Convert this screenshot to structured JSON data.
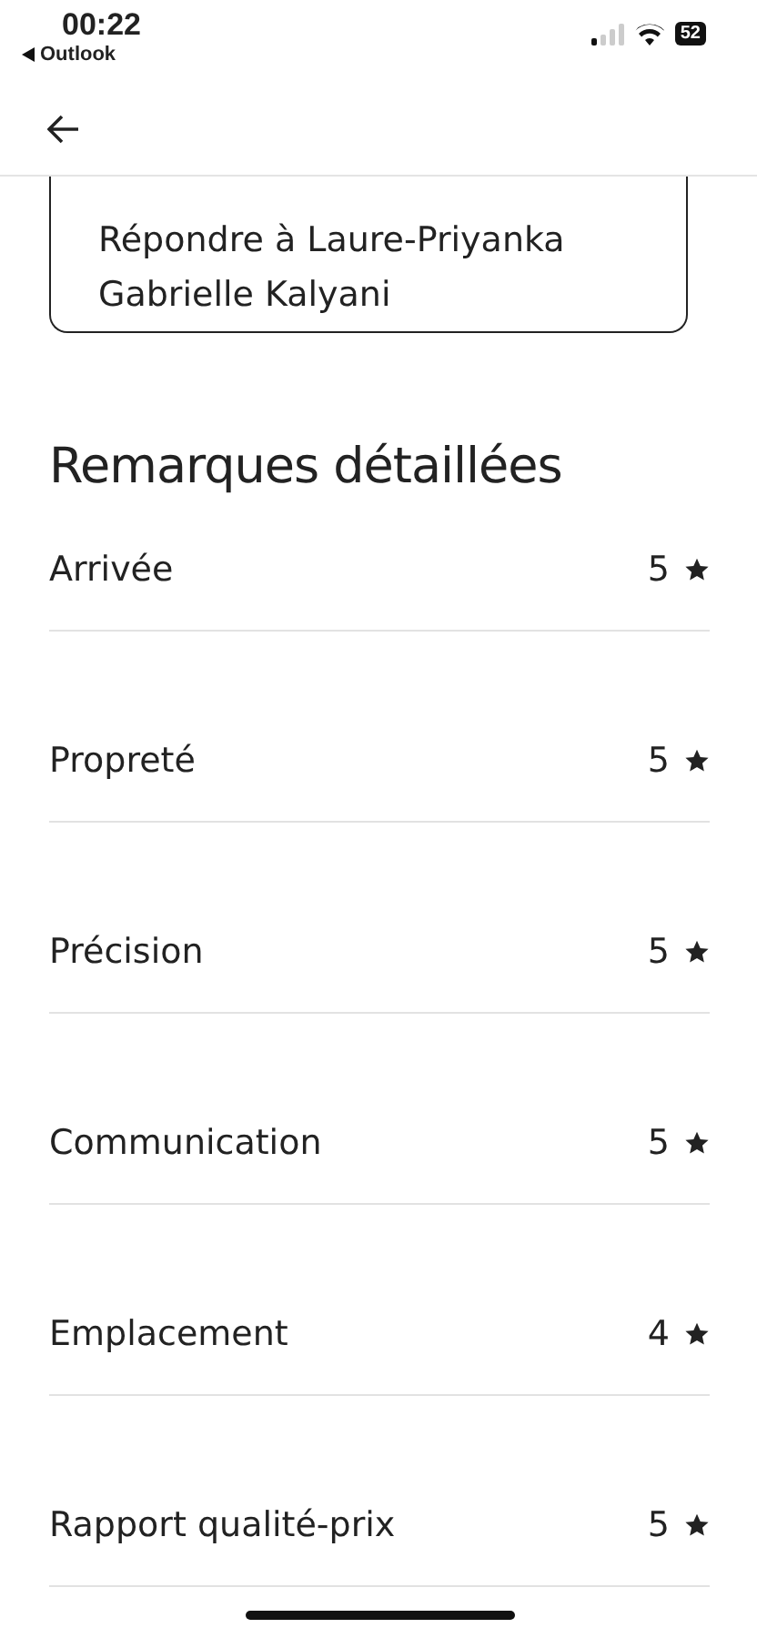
{
  "status_bar": {
    "time": "00:22",
    "back_app": "Outlook",
    "battery": "52"
  },
  "reply_button": {
    "label": "Répondre à Laure-Priyanka Gabrielle Kalyani"
  },
  "section_title": "Remarques détaillées",
  "ratings": [
    {
      "label": "Arrivée",
      "score": "5"
    },
    {
      "label": "Propreté",
      "score": "5"
    },
    {
      "label": "Précision",
      "score": "5"
    },
    {
      "label": "Communication",
      "score": "5"
    },
    {
      "label": "Emplacement",
      "score": "4"
    },
    {
      "label": "Rapport qualité-prix",
      "score": "5"
    }
  ]
}
